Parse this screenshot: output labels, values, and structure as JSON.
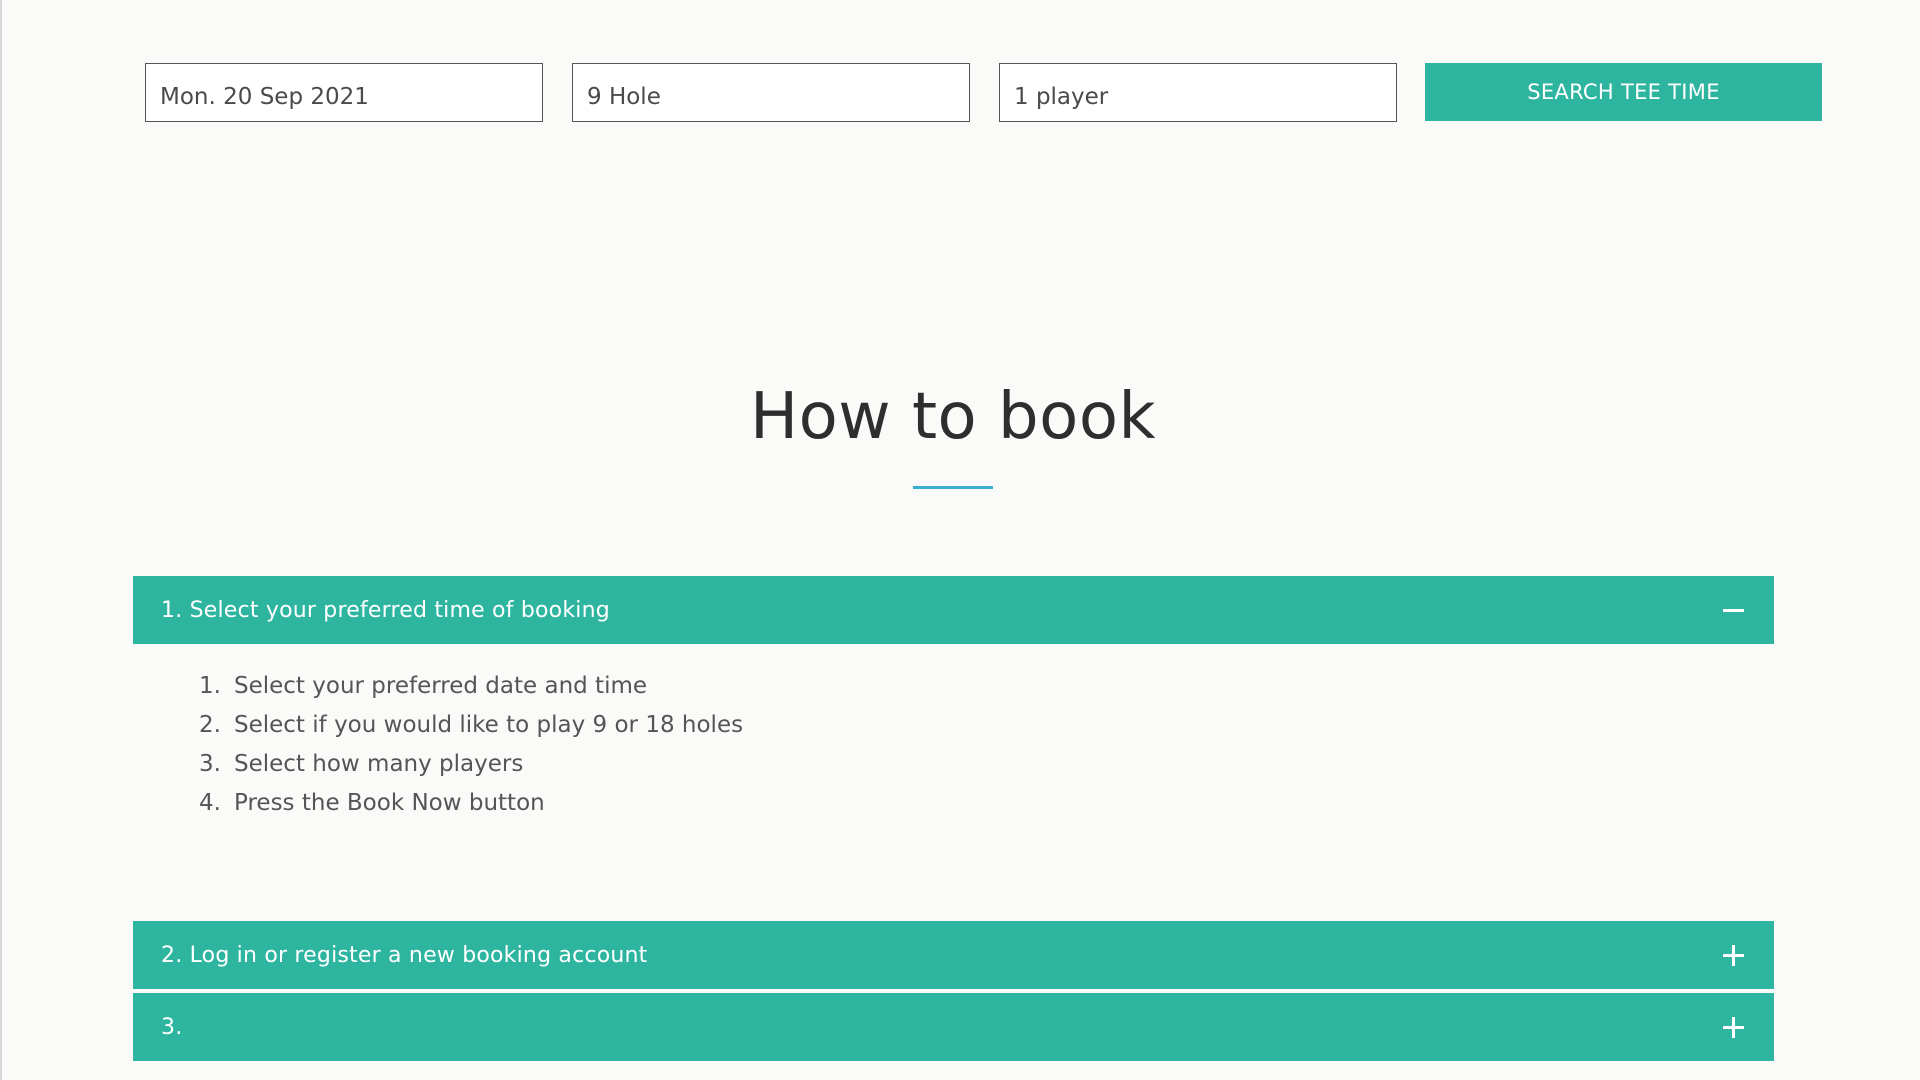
{
  "search": {
    "date_value": "Mon. 20 Sep 2021",
    "holes_value": "9 Hole",
    "players_value": "1 player",
    "button_label": "SEARCH TEE TIME"
  },
  "page": {
    "title": "How to book"
  },
  "accordion": [
    {
      "label": "1. Select your preferred time of booking",
      "state": "expanded",
      "steps": [
        {
          "num": "1.",
          "text": "Select your preferred date and time"
        },
        {
          "num": "2.",
          "text": "Select if you would like to play 9 or 18 holes"
        },
        {
          "num": "3.",
          "text": "Select how many players"
        },
        {
          "num": "4.",
          "text": "Press the Book Now button"
        }
      ]
    },
    {
      "label": "2. Log in or register a new booking account",
      "state": "collapsed"
    },
    {
      "label": "3.",
      "state": "collapsed"
    }
  ],
  "colors": {
    "accent": "#2db5a0",
    "underline": "#3aaed0",
    "background": "#fafaf9"
  },
  "icons": {
    "expanded": "minus-icon",
    "collapsed": "plus-icon"
  }
}
